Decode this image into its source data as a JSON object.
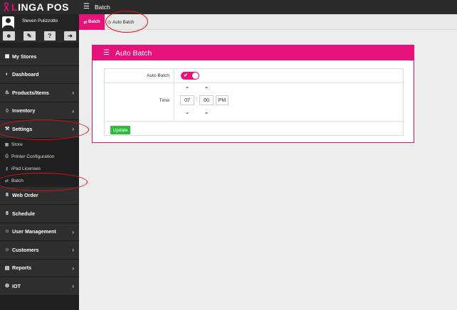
{
  "app": {
    "logo_prefix": "L",
    "logo_text": "INGA POS",
    "page_title": "Batch",
    "brand_color": "#e6127a",
    "success_color": "#2ebd3b"
  },
  "user": {
    "name": "Steven Pulizzotto",
    "actions": [
      "user-icon",
      "brush-icon",
      "help-icon",
      "logout-icon"
    ]
  },
  "sidebar": {
    "items": [
      {
        "label": "My Stores",
        "icon": "store-icon",
        "chevron": false
      },
      {
        "label": "Dashboard",
        "icon": "dashboard-icon",
        "chevron": false
      },
      {
        "label": "Products/Items",
        "icon": "products-icon",
        "chevron": true
      },
      {
        "label": "Inventory",
        "icon": "inventory-icon",
        "chevron": true
      },
      {
        "label": "Settings",
        "icon": "settings-icon",
        "chevron": true
      }
    ],
    "settings_sub": [
      {
        "label": "Store",
        "icon": "store-icon"
      },
      {
        "label": "Printer Configuration",
        "icon": "printer-icon"
      },
      {
        "label": "iPad Licenses",
        "icon": "key-icon"
      },
      {
        "label": "Batch",
        "icon": "batch-icon"
      }
    ],
    "items_after": [
      {
        "label": "Web Order",
        "icon": "web-order-icon",
        "chevron": false
      },
      {
        "label": "Schedule",
        "icon": "schedule-icon",
        "chevron": false
      },
      {
        "label": "User Management",
        "icon": "users-icon",
        "chevron": true
      },
      {
        "label": "Customers",
        "icon": "customers-icon",
        "chevron": true
      },
      {
        "label": "Reports",
        "icon": "reports-icon",
        "chevron": true
      },
      {
        "label": "IOT",
        "icon": "iot-icon",
        "chevron": true
      }
    ]
  },
  "subtabs": {
    "batch": "Batch",
    "auto_batch": "Auto Batch"
  },
  "card": {
    "title": "Auto Batch"
  },
  "form": {
    "auto_batch_label": "Auto Batch",
    "auto_batch_enabled": true,
    "time_label": "Time",
    "hour": "07",
    "minute": "00",
    "period": "PM",
    "update_label": "Update"
  }
}
